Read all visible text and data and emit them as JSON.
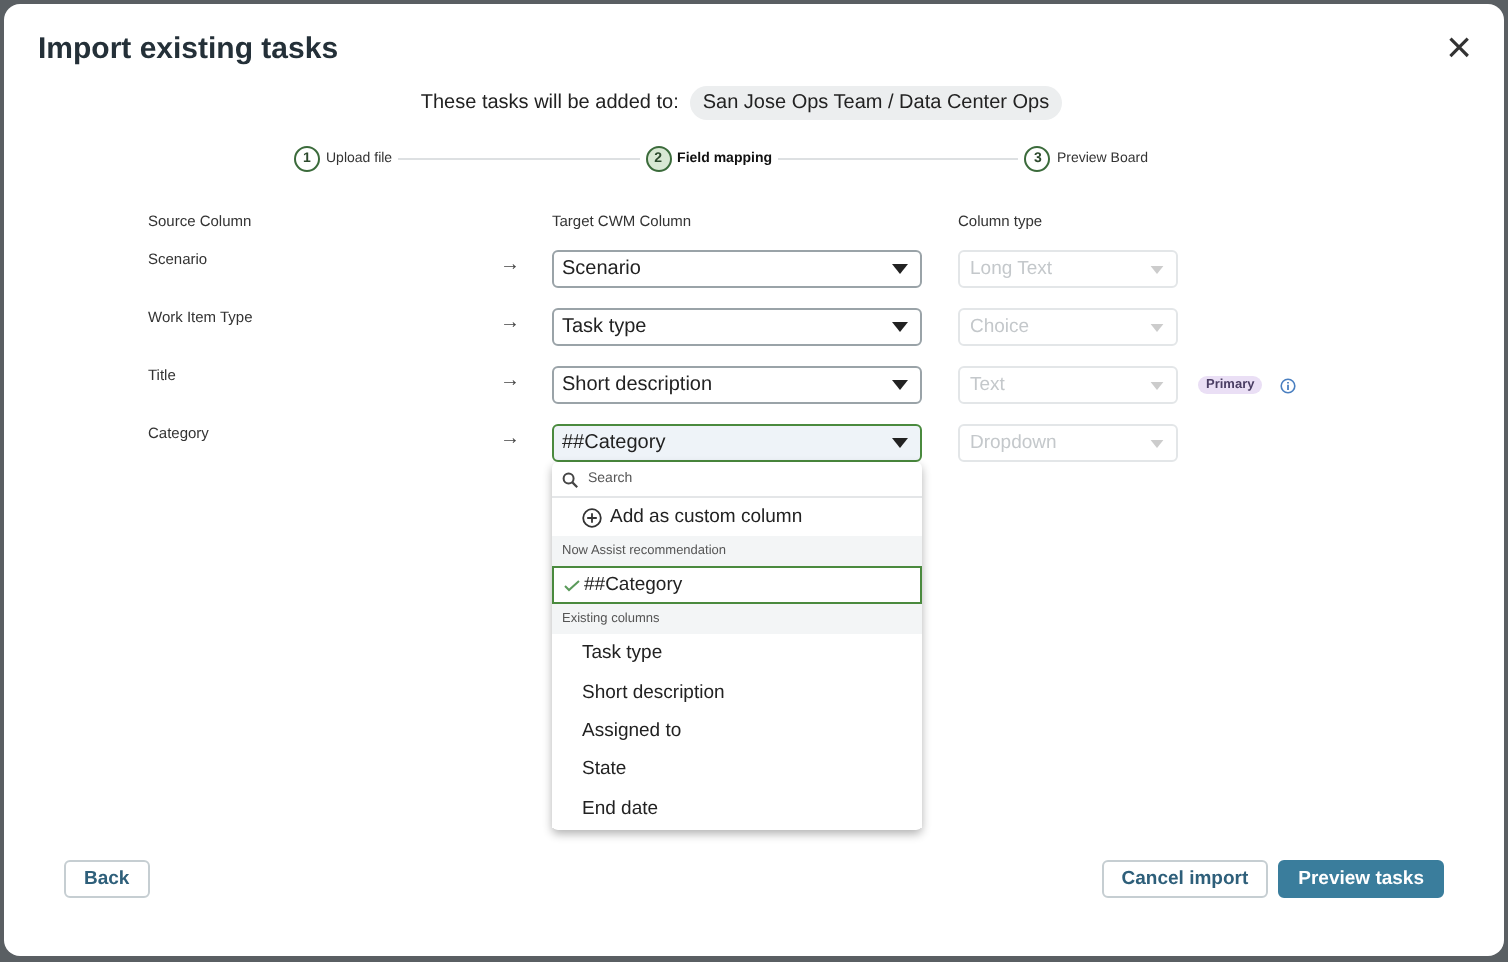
{
  "dialog": {
    "title": "Import existing tasks",
    "close_label": "×"
  },
  "destination": {
    "label": "These tasks will be added to:",
    "value": "San Jose Ops Team / Data Center Ops"
  },
  "steps": [
    {
      "number": "1",
      "label": "Upload file",
      "selected": false
    },
    {
      "number": "2",
      "label": "Field mapping",
      "selected": true
    },
    {
      "number": "3",
      "label": "Preview Board",
      "selected": false
    }
  ],
  "columns": [
    "Source Column",
    "Target CWM Column",
    "Column type"
  ],
  "rows": [
    {
      "source": "Scenario",
      "arrow": "→",
      "target": "Scenario",
      "type": "Long Text",
      "focused": false
    },
    {
      "source": "Work Item Type",
      "arrow": "→",
      "target": "Task type",
      "type": "Choice",
      "focused": false
    },
    {
      "source": "Title",
      "arrow": "→",
      "target": "Short description",
      "type": "Text",
      "focused": false,
      "badge": "Primary",
      "info": true
    },
    {
      "source": "Category",
      "arrow": "→",
      "target": "##Category",
      "type": "Dropdown",
      "focused": true
    }
  ],
  "dropdown": {
    "placeholder": "Search",
    "items": [
      {
        "kind": "action",
        "label": "Add as custom column"
      },
      {
        "kind": "section",
        "label": "Now Assist recommendation"
      },
      {
        "kind": "option",
        "label": "##Category",
        "selected": true
      },
      {
        "kind": "section",
        "label": "Existing columns"
      },
      {
        "kind": "option",
        "label": "Task type",
        "selected": false
      },
      {
        "kind": "option",
        "label": "Short description",
        "selected": false
      },
      {
        "kind": "option",
        "label": "Assigned to",
        "selected": false
      },
      {
        "kind": "option",
        "label": "State",
        "selected": false
      },
      {
        "kind": "option",
        "label": "End date",
        "selected": false
      }
    ]
  },
  "buttons": [
    {
      "kind": "secondary",
      "label": "Back"
    },
    {
      "kind": "secondary",
      "label": "Cancel import"
    },
    {
      "kind": "primary",
      "label": "Preview tasks"
    }
  ]
}
